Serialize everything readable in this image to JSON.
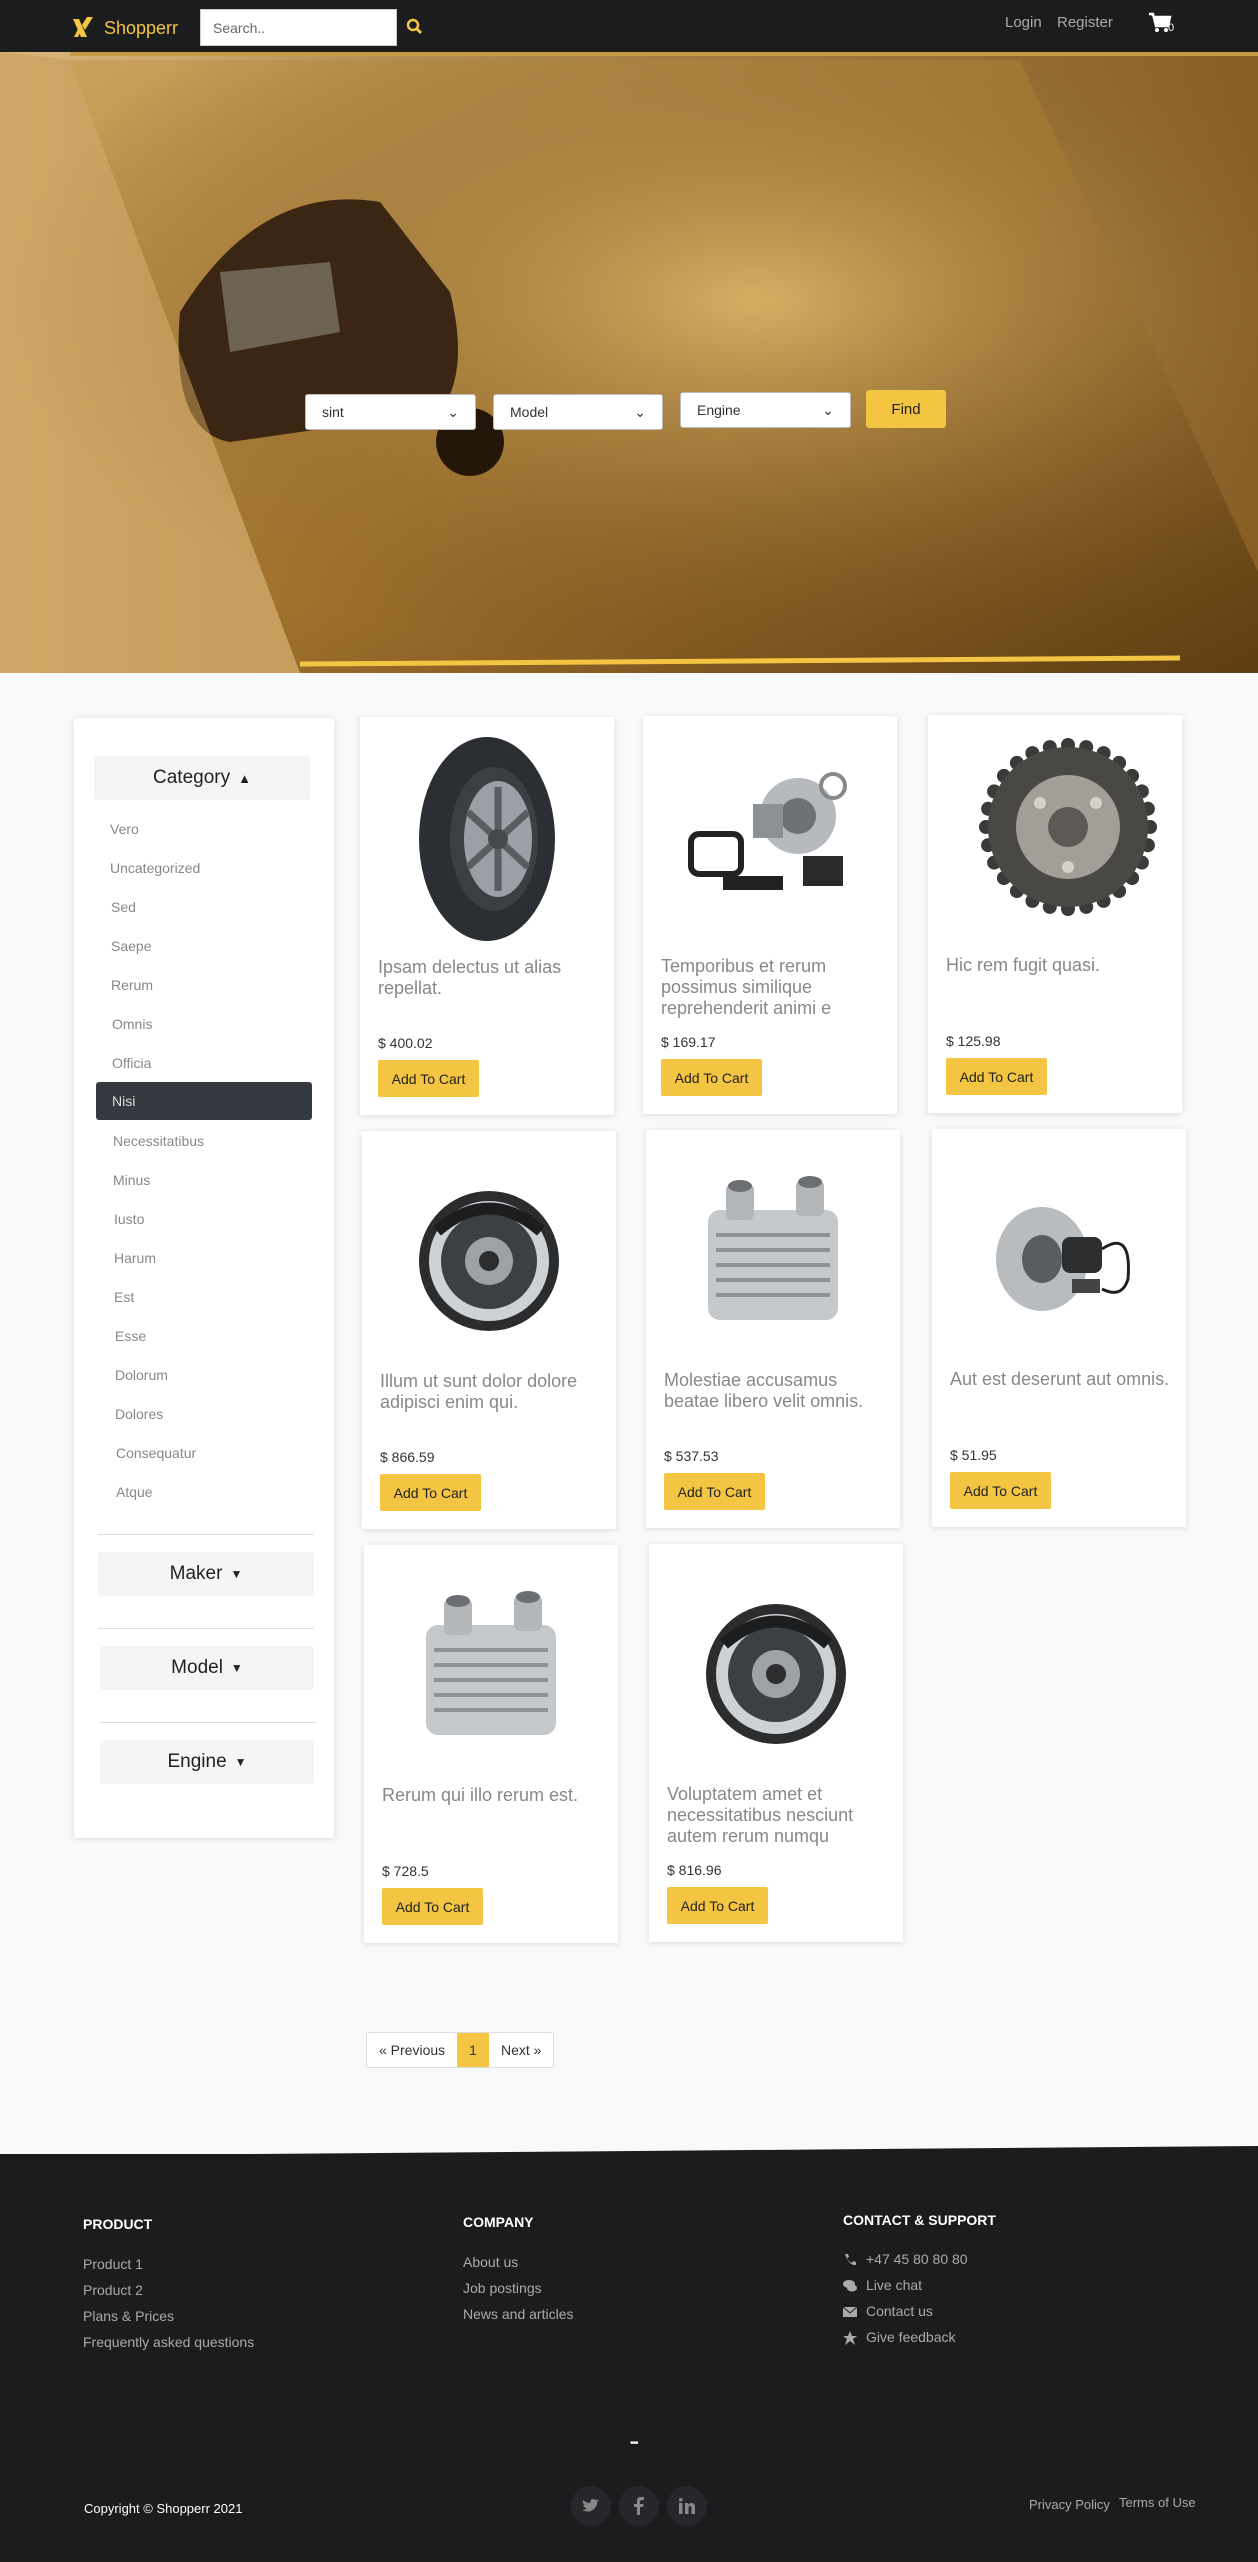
{
  "brand": {
    "name": "Shopperr"
  },
  "search": {
    "placeholder": "Search.."
  },
  "nav": {
    "login": "Login",
    "register": "Register",
    "cart_count": "0"
  },
  "hero": {
    "filters": [
      {
        "value": "sint"
      },
      {
        "value": "Model"
      },
      {
        "value": "Engine"
      }
    ],
    "find_label": "Find"
  },
  "sidebar": {
    "category_label": "Category",
    "categories": [
      "Vero",
      "Uncategorized",
      "Sed",
      "Saepe",
      "Rerum",
      "Omnis",
      "Officia",
      "Nisi",
      "Necessitatibus",
      "Minus",
      "Iusto",
      "Harum",
      "Est",
      "Esse",
      "Dolorum",
      "Dolores",
      "Consequatur",
      "Atque"
    ],
    "active_category": "Nisi",
    "maker_label": "Maker",
    "model_label": "Model",
    "engine_label": "Engine"
  },
  "products": [
    {
      "title": "Ipsam delectus ut alias repellat.",
      "price": "$ 400.02",
      "image": "tire",
      "button": "Add To Cart"
    },
    {
      "title": "Temporibus et rerum possimus similique reprehenderit animi e",
      "price": "$ 169.17",
      "image": "turbo-kit",
      "button": "Add To Cart"
    },
    {
      "title": "Hic rem fugit quasi.",
      "price": "$ 125.98",
      "image": "cam-gear",
      "button": "Add To Cart"
    },
    {
      "title": "Illum ut sunt dolor dolore adipisci enim qui.",
      "price": "$ 866.59",
      "image": "drum-brake",
      "button": "Add To Cart"
    },
    {
      "title": "Molestiae accusamus beatae libero velit omnis.",
      "price": "$ 537.53",
      "image": "oil-cooler",
      "button": "Add To Cart"
    },
    {
      "title": "Aut est deserunt aut omnis.",
      "price": "$ 51.95",
      "image": "brake-disc",
      "button": "Add To Cart"
    },
    {
      "title": "Rerum qui illo rerum est.",
      "price": "$ 728.5",
      "image": "oil-cooler",
      "button": "Add To Cart"
    },
    {
      "title": "Voluptatem amet et necessitatibus nesciunt autem rerum numqu",
      "price": "$ 816.96",
      "image": "drum-brake",
      "button": "Add To Cart"
    }
  ],
  "pagination": {
    "previous": "« Previous",
    "current": "1",
    "next": "Next »"
  },
  "footer": {
    "product": {
      "heading": "PRODUCT",
      "links": [
        "Product 1",
        "Product 2",
        "Plans & Prices",
        "Frequently asked questions"
      ]
    },
    "company": {
      "heading": "COMPANY",
      "links": [
        "About us",
        "Job postings",
        "News and articles"
      ]
    },
    "contact": {
      "heading": "CONTACT & SUPPORT",
      "items": [
        {
          "icon": "phone-icon",
          "label": "+47 45 80 80 80"
        },
        {
          "icon": "chat-icon",
          "label": "Live chat"
        },
        {
          "icon": "envelope-icon",
          "label": "Contact us"
        },
        {
          "icon": "star-icon",
          "label": "Give feedback"
        }
      ]
    },
    "ellipsis": "•••",
    "copyright": "Copyright © Shopperr 2021",
    "social": [
      "twitter-icon",
      "facebook-icon",
      "linkedin-icon"
    ],
    "privacy": "Privacy Policy",
    "terms": "Terms of Use"
  },
  "colors": {
    "accent": "#f4c542",
    "dark": "#1b1c1e",
    "active_item": "#343a40"
  }
}
